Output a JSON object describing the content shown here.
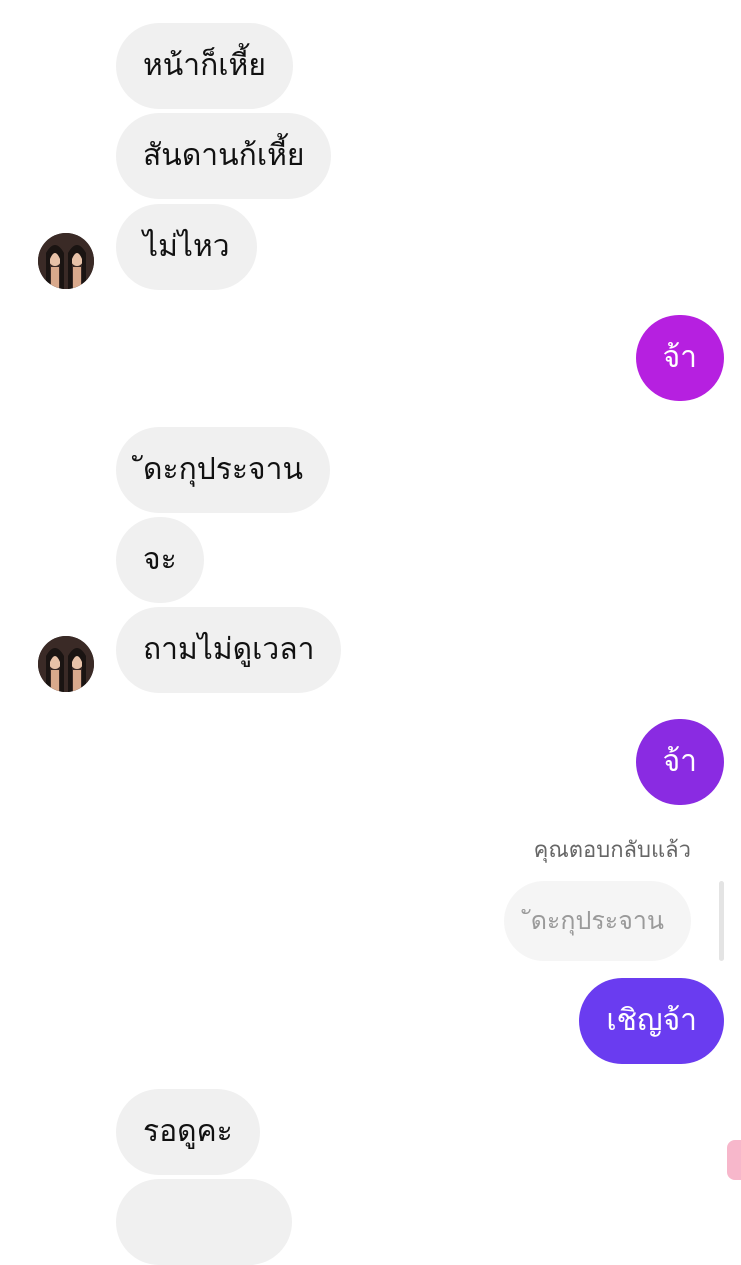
{
  "messages": {
    "m1": "หน้าก็เหี้ย",
    "m2": "สันดานก้เหี้ย",
    "m3": "ไม่ไหว",
    "m4": "จ้า",
    "m5": "ัดะกุประจาน",
    "m6": "จะ",
    "m7": "ถามไม่ดูเวลา",
    "m8": "จ้า",
    "reply_note": "คุณตอบกลับแล้ว",
    "quoted": "ัดะกุประจาน",
    "m9": "เชิญจ้า",
    "m10": "รอดูคะ"
  },
  "colors": {
    "incoming_bubble": "#f0f0f0",
    "outgoing_1": "#b620e0",
    "outgoing_2": "#8a2be2",
    "outgoing_3": "#6a3cf0"
  }
}
